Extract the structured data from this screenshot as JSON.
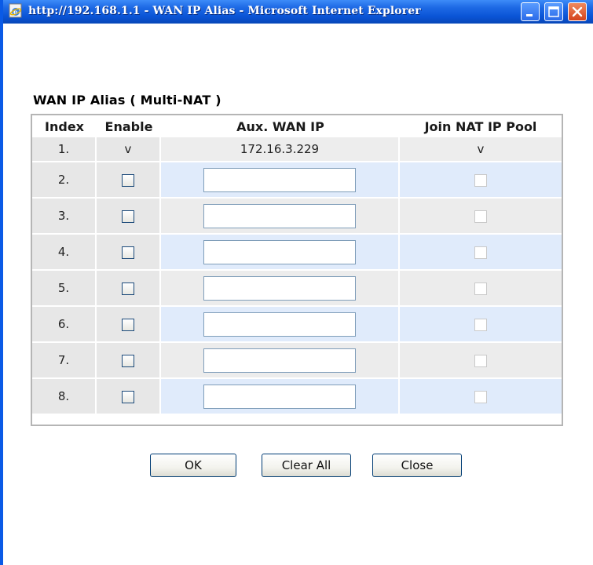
{
  "window": {
    "title": "http://192.168.1.1 - WAN IP Alias - Microsoft Internet Explorer"
  },
  "section": {
    "title": "WAN IP Alias ( Multi-NAT )"
  },
  "table": {
    "headers": {
      "index": "Index",
      "enable": "Enable",
      "aux_wan_ip": "Aux. WAN IP",
      "join_nat_ip_pool": "Join NAT IP Pool"
    },
    "rows": [
      {
        "index": "1.",
        "enable": "v",
        "ip": "172.16.3.229",
        "pool": "v"
      },
      {
        "index": "2.",
        "ip": ""
      },
      {
        "index": "3.",
        "ip": ""
      },
      {
        "index": "4.",
        "ip": ""
      },
      {
        "index": "5.",
        "ip": ""
      },
      {
        "index": "6.",
        "ip": ""
      },
      {
        "index": "7.",
        "ip": ""
      },
      {
        "index": "8.",
        "ip": ""
      }
    ]
  },
  "buttons": {
    "ok": "OK",
    "clear_all": "Clear All",
    "close": "Close"
  },
  "colors": {
    "titlebar": "#0a54d6",
    "row_gray": "#e7e7e7",
    "row_blue": "#e0ebfb"
  }
}
